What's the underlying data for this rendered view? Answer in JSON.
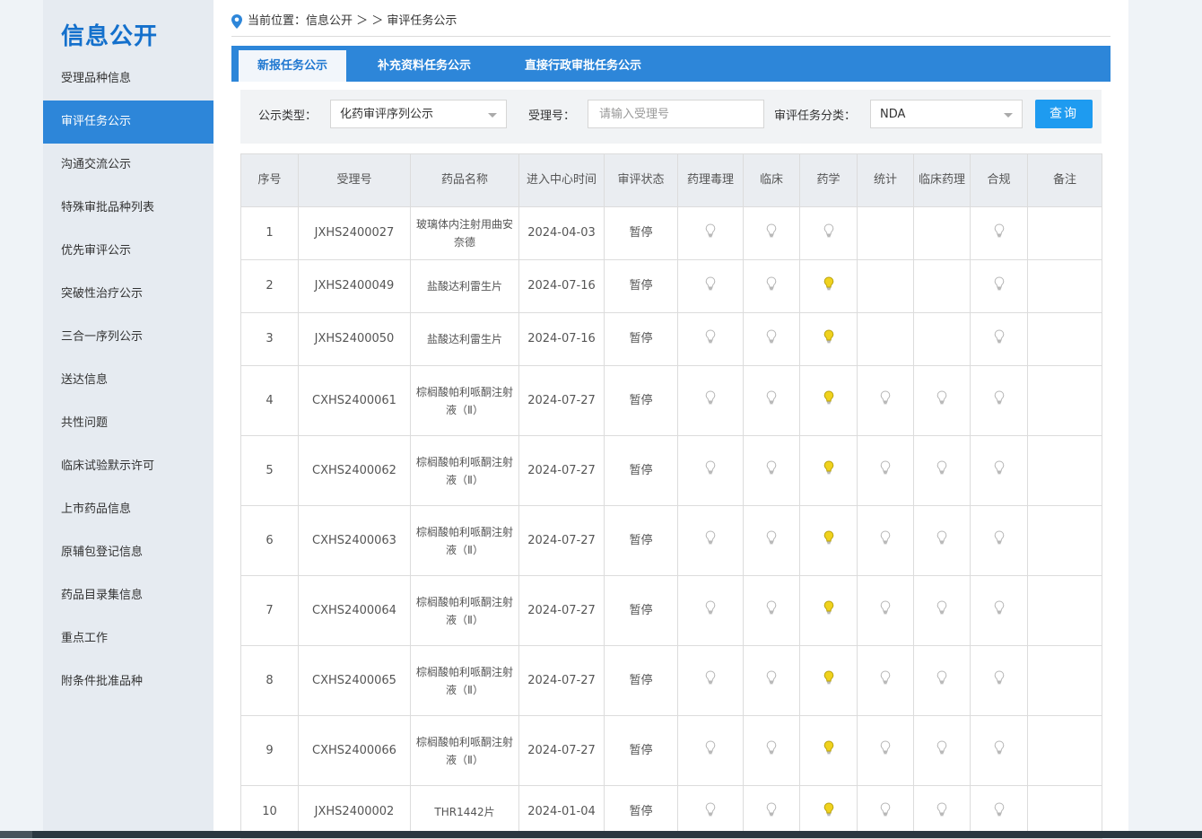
{
  "sidebar": {
    "title": "信息公开",
    "items": [
      {
        "label": "受理品种信息"
      },
      {
        "label": "审评任务公示"
      },
      {
        "label": "沟通交流公示"
      },
      {
        "label": "特殊审批品种列表"
      },
      {
        "label": "优先审评公示"
      },
      {
        "label": "突破性治疗公示"
      },
      {
        "label": "三合一序列公示"
      },
      {
        "label": "送达信息"
      },
      {
        "label": "共性问题"
      },
      {
        "label": "临床试验默示许可"
      },
      {
        "label": "上市药品信息"
      },
      {
        "label": "原辅包登记信息"
      },
      {
        "label": "药品目录集信息"
      },
      {
        "label": "重点工作"
      },
      {
        "label": "附条件批准品种"
      }
    ]
  },
  "breadcrumb": {
    "text": "当前位置：信息公开 ＞ ＞ 审评任务公示"
  },
  "tabs": [
    {
      "label": "新报任务公示"
    },
    {
      "label": "补充资料任务公示"
    },
    {
      "label": "直接行政审批任务公示"
    }
  ],
  "filter": {
    "type_label": "公示类型：",
    "type_value": "化药审评序列公示",
    "accept_label": "受理号：",
    "accept_placeholder": "请输入受理号",
    "category_label": "审评任务分类：",
    "category_value": "NDA",
    "query_label": "查询"
  },
  "table": {
    "headers": {
      "seq": "序号",
      "accept_no": "受理号",
      "drug_name": "药品名称",
      "enter_time": "进入中心时间",
      "status": "审评状态",
      "pharmtox": "药理毒理",
      "clinical": "临床",
      "pharmacy": "药学",
      "stats": "统计",
      "clinpharm": "临床药理",
      "compliance": "合规",
      "remark": "备注"
    },
    "rows": [
      {
        "seq": "1",
        "accept_no": "JXHS2400027",
        "drug_name": "玻璃体内注射用曲安奈德",
        "enter_time": "2024-04-03",
        "status": "暂停",
        "pharmtox": "off",
        "clinical": "off",
        "pharmacy": "off",
        "stats": "",
        "clinpharm": "",
        "compliance": "off",
        "remark": ""
      },
      {
        "seq": "2",
        "accept_no": "JXHS2400049",
        "drug_name": "盐酸达利雷生片",
        "enter_time": "2024-07-16",
        "status": "暂停",
        "pharmtox": "off",
        "clinical": "off",
        "pharmacy": "on",
        "stats": "",
        "clinpharm": "",
        "compliance": "off",
        "remark": ""
      },
      {
        "seq": "3",
        "accept_no": "JXHS2400050",
        "drug_name": "盐酸达利雷生片",
        "enter_time": "2024-07-16",
        "status": "暂停",
        "pharmtox": "off",
        "clinical": "off",
        "pharmacy": "on",
        "stats": "",
        "clinpharm": "",
        "compliance": "off",
        "remark": ""
      },
      {
        "seq": "4",
        "accept_no": "CXHS2400061",
        "drug_name": "棕榈酸帕利哌酮注射液（Ⅱ）",
        "enter_time": "2024-07-27",
        "status": "暂停",
        "pharmtox": "off",
        "clinical": "off",
        "pharmacy": "on",
        "stats": "off",
        "clinpharm": "off",
        "compliance": "off",
        "remark": ""
      },
      {
        "seq": "5",
        "accept_no": "CXHS2400062",
        "drug_name": "棕榈酸帕利哌酮注射液（Ⅱ）",
        "enter_time": "2024-07-27",
        "status": "暂停",
        "pharmtox": "off",
        "clinical": "off",
        "pharmacy": "on",
        "stats": "off",
        "clinpharm": "off",
        "compliance": "off",
        "remark": ""
      },
      {
        "seq": "6",
        "accept_no": "CXHS2400063",
        "drug_name": "棕榈酸帕利哌酮注射液（Ⅱ）",
        "enter_time": "2024-07-27",
        "status": "暂停",
        "pharmtox": "off",
        "clinical": "off",
        "pharmacy": "on",
        "stats": "off",
        "clinpharm": "off",
        "compliance": "off",
        "remark": ""
      },
      {
        "seq": "7",
        "accept_no": "CXHS2400064",
        "drug_name": "棕榈酸帕利哌酮注射液（Ⅱ）",
        "enter_time": "2024-07-27",
        "status": "暂停",
        "pharmtox": "off",
        "clinical": "off",
        "pharmacy": "on",
        "stats": "off",
        "clinpharm": "off",
        "compliance": "off",
        "remark": ""
      },
      {
        "seq": "8",
        "accept_no": "CXHS2400065",
        "drug_name": "棕榈酸帕利哌酮注射液（Ⅱ）",
        "enter_time": "2024-07-27",
        "status": "暂停",
        "pharmtox": "off",
        "clinical": "off",
        "pharmacy": "on",
        "stats": "off",
        "clinpharm": "off",
        "compliance": "off",
        "remark": ""
      },
      {
        "seq": "9",
        "accept_no": "CXHS2400066",
        "drug_name": "棕榈酸帕利哌酮注射液（Ⅱ）",
        "enter_time": "2024-07-27",
        "status": "暂停",
        "pharmtox": "off",
        "clinical": "off",
        "pharmacy": "on",
        "stats": "off",
        "clinpharm": "off",
        "compliance": "off",
        "remark": ""
      },
      {
        "seq": "10",
        "accept_no": "JXHS2400002",
        "drug_name": "THR1442片",
        "enter_time": "2024-01-04",
        "status": "暂停",
        "pharmtox": "off",
        "clinical": "off",
        "pharmacy": "on",
        "stats": "off",
        "clinpharm": "off",
        "compliance": "off",
        "remark": ""
      }
    ]
  },
  "icons": {
    "location": "map-pin-icon",
    "bulb": "lightbulb-icon",
    "dropdown": "chevron-down-icon"
  },
  "colors": {
    "brand_blue": "#2d86d9",
    "title_blue": "#1470cc",
    "query_button": "#1e9bf0",
    "bulb_on": "#f0d21e",
    "bulb_off": "#cfcfcf"
  }
}
